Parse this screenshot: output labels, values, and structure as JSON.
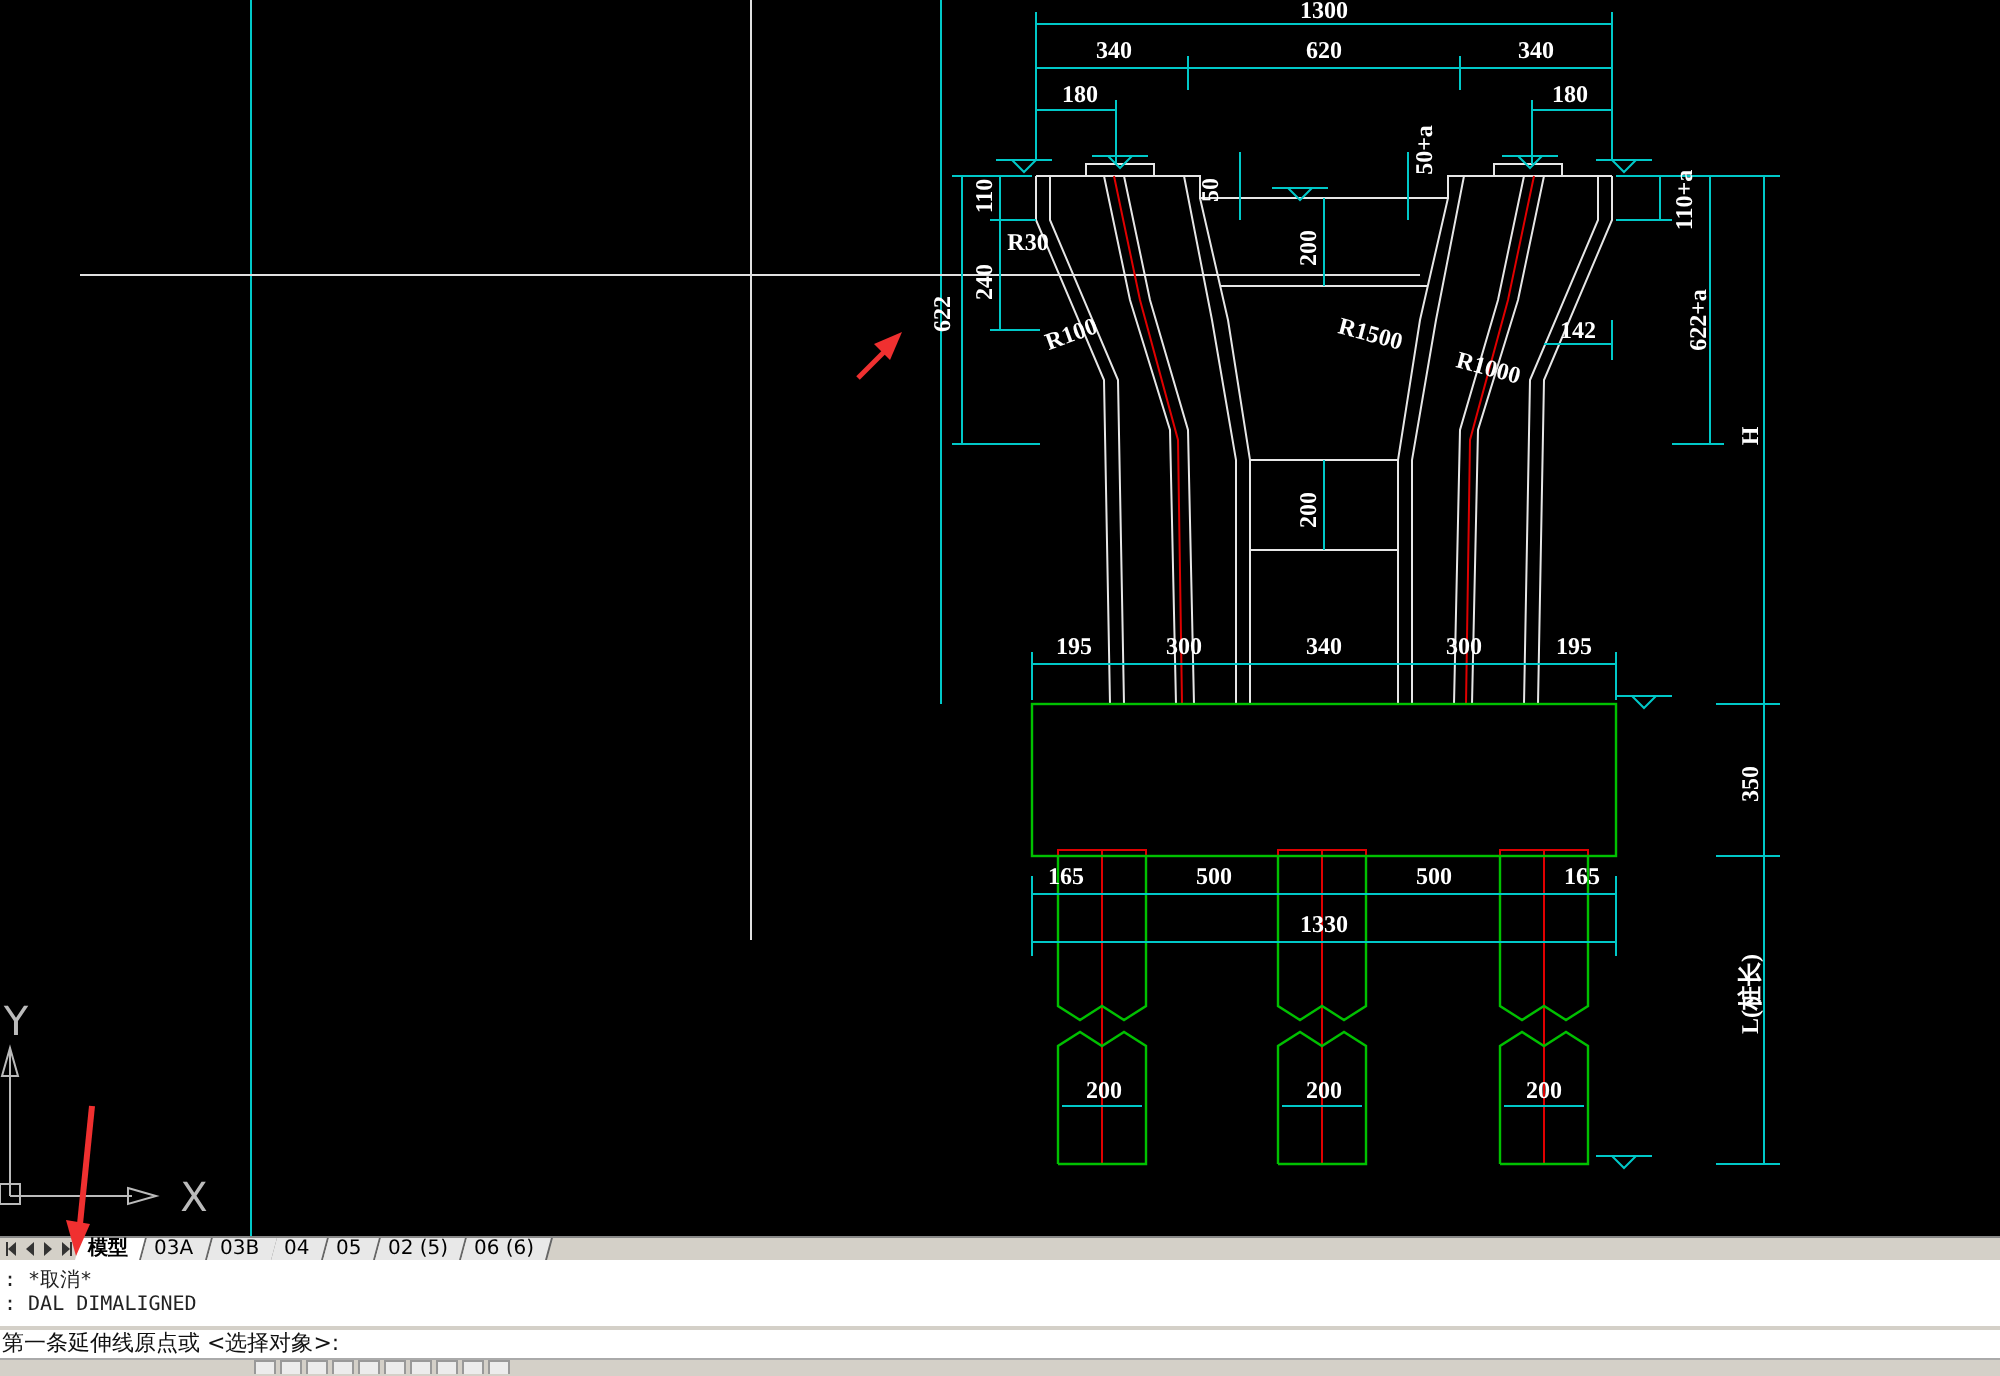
{
  "drawing": {
    "dimension_texts": [
      "1300",
      "340",
      "620",
      "340",
      "180",
      "180",
      "110",
      "R30",
      "240",
      "622",
      "R100",
      "50",
      "200",
      "50+a",
      "R1500",
      "R1000",
      "142",
      "110+a",
      "622+a",
      "H",
      "200",
      "195",
      "300",
      "340",
      "300",
      "195",
      "350",
      "165",
      "500",
      "500",
      "165",
      "1330",
      "L(桩长)",
      "200",
      "200",
      "200"
    ]
  },
  "ucs_icon": {
    "y_label": "Y",
    "x_label": "X"
  },
  "layout_tabs": [
    {
      "label": "模型",
      "selected": true
    },
    {
      "label": "03A",
      "selected": false
    },
    {
      "label": "03B",
      "selected": false
    },
    {
      "label": "04",
      "selected": false
    },
    {
      "label": "05",
      "selected": false
    },
    {
      "label": "02 (5)",
      "selected": false
    },
    {
      "label": "06 (6)",
      "selected": false
    }
  ],
  "command_history": [
    ": *取消*",
    ": DAL DIMALIGNED"
  ],
  "command_prompt": "第一条延伸线原点或 <选择对象>:"
}
